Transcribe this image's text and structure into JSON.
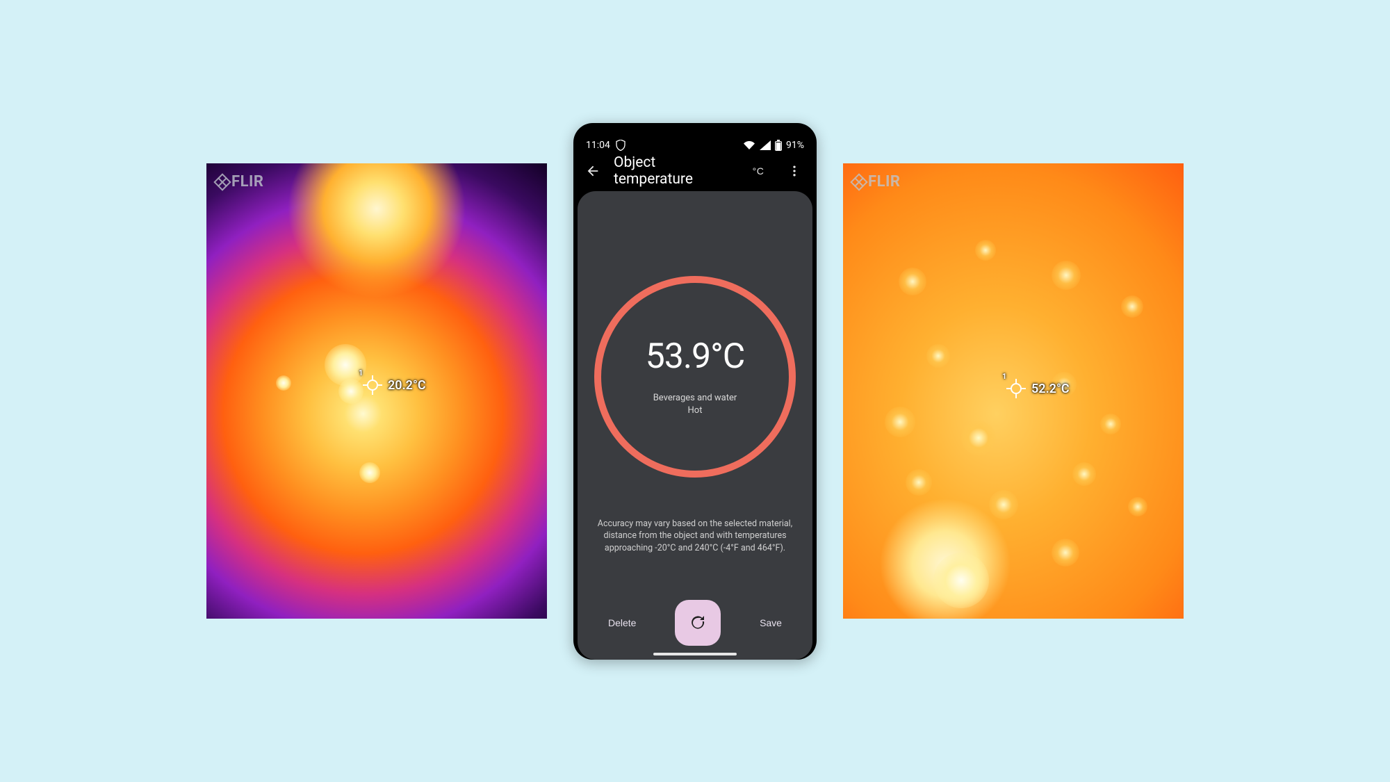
{
  "thermal_left": {
    "brand": "FLIR",
    "point_index": "1",
    "point_temp": "20.2°C"
  },
  "thermal_right": {
    "brand": "FLIR",
    "point_index": "1",
    "point_temp": "52.2°C"
  },
  "phone": {
    "status": {
      "time": "11:04",
      "battery_pct": "91%"
    },
    "appbar": {
      "title": "Object temperature",
      "unit_button": "°C"
    },
    "reading": {
      "value": "53.9°C",
      "category_line1": "Beverages and water",
      "category_line2": "Hot"
    },
    "disclaimer": "Accuracy may vary based on the selected material, distance from the object and with temperatures approaching -20°C and 240°C (-4°F and 464°F).",
    "actions": {
      "delete": "Delete",
      "save": "Save"
    }
  }
}
